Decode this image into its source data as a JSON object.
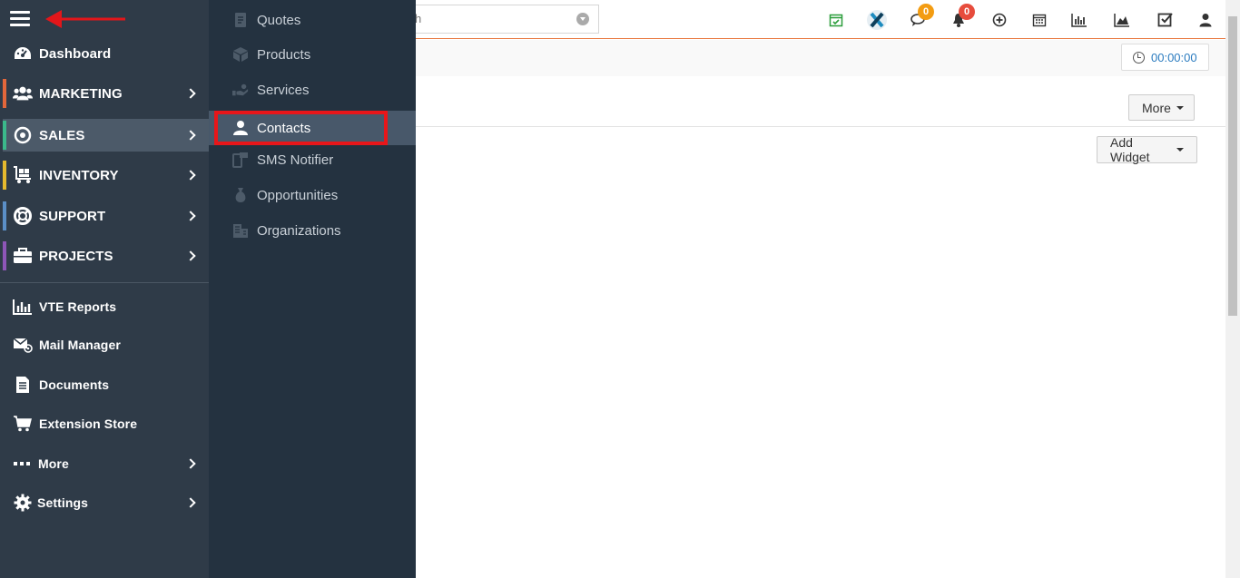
{
  "search": {
    "text": "h"
  },
  "timer": {
    "value": "00:00:00"
  },
  "toolbar": {
    "more_label": "More",
    "add_widget_label": "Add Widget"
  },
  "badges": {
    "messages_count": "0",
    "notifications_count": "0",
    "messages_color": "#f39c12",
    "notifications_color": "#e74c3c"
  },
  "sidebar": {
    "items": [
      {
        "label": "Dashboard",
        "icon": "dashboard-icon"
      },
      {
        "label": "MARKETING",
        "icon": "users-icon",
        "color": "#e3673b"
      },
      {
        "label": "SALES",
        "icon": "target-icon",
        "color": "#3bb98b"
      },
      {
        "label": "INVENTORY",
        "icon": "cart-icon",
        "color": "#e5b92e"
      },
      {
        "label": "SUPPORT",
        "icon": "lifebuoy-icon",
        "color": "#5b8fc7"
      },
      {
        "label": "PROJECTS",
        "icon": "briefcase-icon",
        "color": "#8e56b7"
      },
      {
        "label": "VTE Reports",
        "icon": "bar-chart-icon"
      },
      {
        "label": "Mail Manager",
        "icon": "mail-icon"
      },
      {
        "label": "Documents",
        "icon": "document-icon"
      },
      {
        "label": "Extension Store",
        "icon": "shopping-cart-icon"
      },
      {
        "label": "More",
        "icon": "ellipsis-icon"
      },
      {
        "label": "Settings",
        "icon": "gear-icon"
      }
    ]
  },
  "submenu": {
    "items": [
      {
        "label": "Quotes",
        "icon": "quote-icon"
      },
      {
        "label": "Products",
        "icon": "box-icon"
      },
      {
        "label": "Services",
        "icon": "service-icon"
      },
      {
        "label": "Contacts",
        "icon": "user-icon"
      },
      {
        "label": "SMS Notifier",
        "icon": "sms-icon"
      },
      {
        "label": "Opportunities",
        "icon": "money-bag-icon"
      },
      {
        "label": "Organizations",
        "icon": "building-icon"
      }
    ]
  }
}
